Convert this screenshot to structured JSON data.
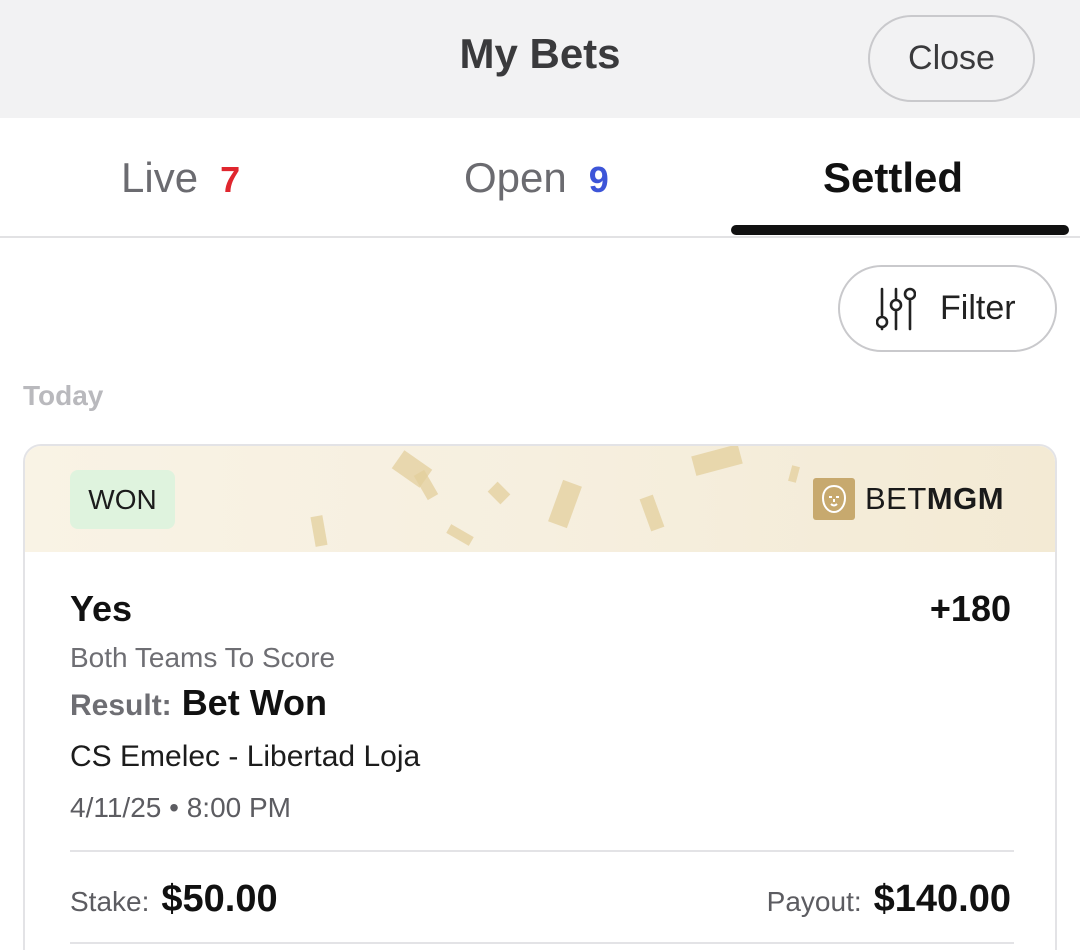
{
  "header": {
    "title": "My Bets",
    "close_label": "Close"
  },
  "tabs": [
    {
      "label": "Live",
      "count": "7",
      "count_color": "#e0262e",
      "active": false
    },
    {
      "label": "Open",
      "count": "9",
      "count_color": "#3d55d8",
      "active": false
    },
    {
      "label": "Settled",
      "active": true
    }
  ],
  "filter": {
    "label": "Filter",
    "icon": "sliders-icon"
  },
  "section": {
    "label": "Today"
  },
  "bet": {
    "status": "WON",
    "status_color": "#dff3de",
    "brand_prefix": "BET",
    "brand_suffix": "MGM",
    "brand_icon": "lion-logo-icon",
    "selection": "Yes",
    "odds": "+180",
    "market": "Both Teams To Score",
    "result_label": "Result:",
    "result_value": "Bet Won",
    "event": "CS Emelec - Libertad Loja",
    "date": "4/11/25",
    "time": "8:00 PM",
    "stake_label": "Stake:",
    "stake_value": "$50.00",
    "payout_label": "Payout:",
    "payout_value": "$140.00"
  }
}
